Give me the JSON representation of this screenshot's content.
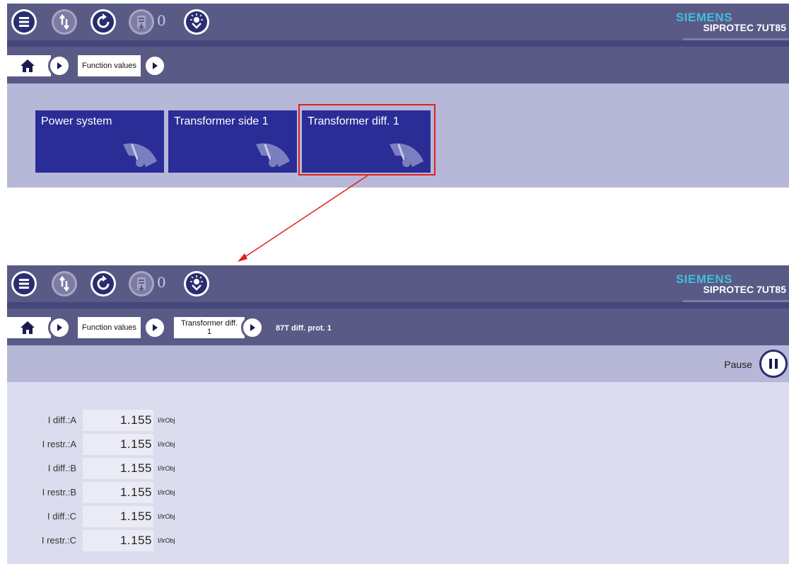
{
  "toolbar": {
    "buttons": [
      {
        "icon": "menu-icon"
      },
      {
        "icon": "transfer-icon"
      },
      {
        "icon": "refresh-icon"
      },
      {
        "icon": "device-log-icon"
      },
      {
        "icon": "led-reset-icon"
      }
    ],
    "log_count": "0",
    "brand": "SIEMENS",
    "product": "SIPROTEC 7UT85"
  },
  "top_view": {
    "breadcrumb": [
      "Function values"
    ],
    "tiles": [
      {
        "label": "Power system",
        "icon": "gauge-icon"
      },
      {
        "label": "Transformer side 1",
        "icon": "gauge-icon"
      },
      {
        "label": "Transformer diff. 1",
        "icon": "gauge-icon",
        "highlighted": true
      }
    ]
  },
  "bottom_view": {
    "breadcrumb": [
      "Function values",
      "Transformer diff.",
      "1"
    ],
    "breadcrumb_current": "87T diff. prot. 1",
    "pause_label": "Pause",
    "values": [
      {
        "label": "I diff.:A",
        "value": "1.155",
        "unit": "I/IrObj"
      },
      {
        "label": "I restr.:A",
        "value": "1.155",
        "unit": "I/IrObj"
      },
      {
        "label": "I diff.:B",
        "value": "1.155",
        "unit": "I/IrObj"
      },
      {
        "label": "I restr.:B",
        "value": "1.155",
        "unit": "I/IrObj"
      },
      {
        "label": "I diff.:C",
        "value": "1.155",
        "unit": "I/IrObj"
      },
      {
        "label": "I restr.:C",
        "value": "1.155",
        "unit": "I/IrObj"
      }
    ]
  },
  "colors": {
    "toolbar": "#5a5a86",
    "tile": "#2a2d96",
    "tile_area": "#b7b8d8",
    "values_area": "#dcdcef",
    "highlight": "#e02020",
    "brand": "#3fc0d8"
  }
}
